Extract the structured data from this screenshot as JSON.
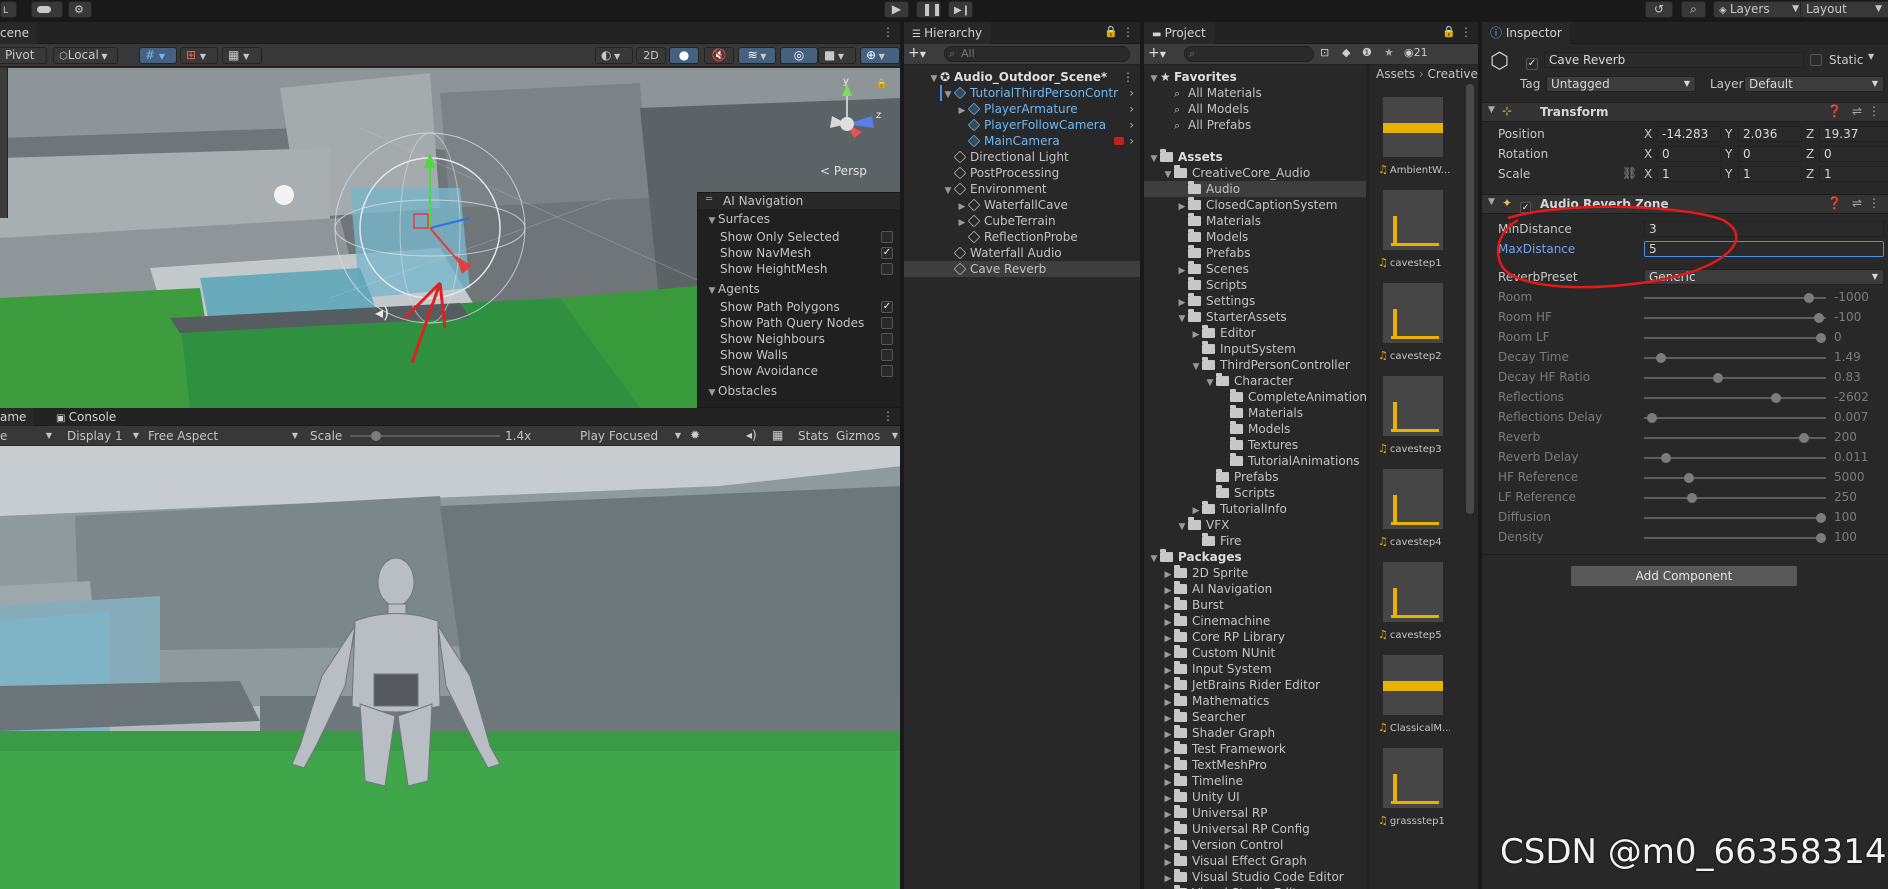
{
  "toolbar": {
    "layers_label": "Layers",
    "layout_label": "Layout"
  },
  "scene": {
    "tab": "cene",
    "pivot": "Pivot",
    "local": "Local",
    "mode_2d": "2D",
    "persp": "Persp",
    "ai_nav": {
      "title": "AI Navigation",
      "sections": [
        {
          "title": "Surfaces",
          "items": [
            {
              "label": "Show Only Selected",
              "checked": false
            },
            {
              "label": "Show NavMesh",
              "checked": true
            },
            {
              "label": "Show HeightMesh",
              "checked": false
            }
          ]
        },
        {
          "title": "Agents",
          "items": [
            {
              "label": "Show Path Polygons",
              "checked": true
            },
            {
              "label": "Show Path Query Nodes",
              "checked": false
            },
            {
              "label": "Show Neighbours",
              "checked": false
            },
            {
              "label": "Show Walls",
              "checked": false
            },
            {
              "label": "Show Avoidance",
              "checked": false
            }
          ]
        },
        {
          "title": "Obstacles",
          "items": []
        }
      ]
    }
  },
  "game": {
    "tab": "ame",
    "console_tab": "Console",
    "display_left": "e",
    "display": "Display 1",
    "aspect": "Free Aspect",
    "scale_label": "Scale",
    "scale_value": "1.4x",
    "scale_fraction": 0.15,
    "play_focused": "Play Focused",
    "stats": "Stats",
    "gizmos": "Gizmos"
  },
  "hierarchy": {
    "tab": "Hierarchy",
    "search_placeholder": "All",
    "items": [
      {
        "label": "Audio_Outdoor_Scene*",
        "depth": 0,
        "type": "scene",
        "arrow": "down",
        "blue": false,
        "bold": true,
        "selected": false,
        "more": true
      },
      {
        "label": "TutorialThirdPersonContr",
        "depth": 1,
        "type": "cube",
        "arrow": "down",
        "blue": true,
        "bold": false,
        "selected": false,
        "chevron": true
      },
      {
        "label": "PlayerArmature",
        "depth": 2,
        "type": "cube",
        "arrow": "right",
        "blue": true,
        "bold": false,
        "selected": false,
        "chevron": true
      },
      {
        "label": "PlayerFollowCamera",
        "depth": 2,
        "type": "cube",
        "arrow": "",
        "blue": true,
        "bold": false,
        "selected": false,
        "chevron": true
      },
      {
        "label": "MainCamera",
        "depth": 2,
        "type": "cube",
        "arrow": "",
        "blue": true,
        "bold": false,
        "selected": false,
        "chevron": true,
        "warn": true
      },
      {
        "label": "Directional Light",
        "depth": 1,
        "type": "cube",
        "arrow": "",
        "blue": false,
        "bold": false,
        "selected": false
      },
      {
        "label": "PostProcessing",
        "depth": 1,
        "type": "cube",
        "arrow": "",
        "blue": false,
        "bold": false,
        "selected": false
      },
      {
        "label": "Environment",
        "depth": 1,
        "type": "cube",
        "arrow": "down",
        "blue": false,
        "bold": false,
        "selected": false
      },
      {
        "label": "WaterfallCave",
        "depth": 2,
        "type": "cube",
        "arrow": "right",
        "blue": false,
        "bold": false,
        "selected": false
      },
      {
        "label": "CubeTerrain",
        "depth": 2,
        "type": "cube",
        "arrow": "right",
        "blue": false,
        "bold": false,
        "selected": false
      },
      {
        "label": "ReflectionProbe",
        "depth": 2,
        "type": "cube",
        "arrow": "",
        "blue": false,
        "bold": false,
        "selected": false
      },
      {
        "label": "Waterfall Audio",
        "depth": 1,
        "type": "cube",
        "arrow": "",
        "blue": false,
        "bold": false,
        "selected": false
      },
      {
        "label": "Cave Reverb",
        "depth": 1,
        "type": "cube",
        "arrow": "",
        "blue": false,
        "bold": false,
        "selected": true
      }
    ]
  },
  "project": {
    "tab": "Project",
    "hidden_count": "21",
    "breadcrumb_assets": "Assets",
    "breadcrumb_next": "CreativeC",
    "tree": [
      {
        "label": "Favorites",
        "depth": 0,
        "type": "star",
        "arrow": "down",
        "bold": true
      },
      {
        "label": "All Materials",
        "depth": 1,
        "type": "search",
        "arrow": ""
      },
      {
        "label": "All Models",
        "depth": 1,
        "type": "search",
        "arrow": ""
      },
      {
        "label": "All Prefabs",
        "depth": 1,
        "type": "search",
        "arrow": ""
      },
      {
        "label": "",
        "depth": 0,
        "type": "gap",
        "arrow": ""
      },
      {
        "label": "Assets",
        "depth": 0,
        "type": "folder",
        "arrow": "down",
        "bold": true
      },
      {
        "label": "CreativeCore_Audio",
        "depth": 1,
        "type": "folder",
        "arrow": "down"
      },
      {
        "label": "Audio",
        "depth": 2,
        "type": "folder",
        "arrow": "",
        "selected": true
      },
      {
        "label": "ClosedCaptionSystem",
        "depth": 2,
        "type": "folder",
        "arrow": "right"
      },
      {
        "label": "Materials",
        "depth": 2,
        "type": "folder",
        "arrow": ""
      },
      {
        "label": "Models",
        "depth": 2,
        "type": "folder",
        "arrow": ""
      },
      {
        "label": "Prefabs",
        "depth": 2,
        "type": "folder",
        "arrow": ""
      },
      {
        "label": "Scenes",
        "depth": 2,
        "type": "folder",
        "arrow": "right"
      },
      {
        "label": "Scripts",
        "depth": 2,
        "type": "folder",
        "arrow": ""
      },
      {
        "label": "Settings",
        "depth": 2,
        "type": "folder",
        "arrow": "right"
      },
      {
        "label": "StarterAssets",
        "depth": 2,
        "type": "folder",
        "arrow": "down"
      },
      {
        "label": "Editor",
        "depth": 3,
        "type": "folder",
        "arrow": "right"
      },
      {
        "label": "InputSystem",
        "depth": 3,
        "type": "folder",
        "arrow": ""
      },
      {
        "label": "ThirdPersonController",
        "depth": 3,
        "type": "folder",
        "arrow": "down"
      },
      {
        "label": "Character",
        "depth": 4,
        "type": "folder",
        "arrow": "down"
      },
      {
        "label": "CompleteAnimations",
        "depth": 5,
        "type": "folder",
        "arrow": ""
      },
      {
        "label": "Materials",
        "depth": 5,
        "type": "folder",
        "arrow": ""
      },
      {
        "label": "Models",
        "depth": 5,
        "type": "folder",
        "arrow": ""
      },
      {
        "label": "Textures",
        "depth": 5,
        "type": "folder",
        "arrow": ""
      },
      {
        "label": "TutorialAnimations",
        "depth": 5,
        "type": "folder",
        "arrow": ""
      },
      {
        "label": "Prefabs",
        "depth": 4,
        "type": "folder",
        "arrow": ""
      },
      {
        "label": "Scripts",
        "depth": 4,
        "type": "folder",
        "arrow": ""
      },
      {
        "label": "TutorialInfo",
        "depth": 3,
        "type": "folder",
        "arrow": "right"
      },
      {
        "label": "VFX",
        "depth": 2,
        "type": "folder",
        "arrow": "down"
      },
      {
        "label": "Fire",
        "depth": 3,
        "type": "folder",
        "arrow": ""
      },
      {
        "label": "Packages",
        "depth": 0,
        "type": "folder",
        "arrow": "down",
        "bold": true
      },
      {
        "label": "2D Sprite",
        "depth": 1,
        "type": "folder",
        "arrow": "right"
      },
      {
        "label": "AI Navigation",
        "depth": 1,
        "type": "folder",
        "arrow": "right"
      },
      {
        "label": "Burst",
        "depth": 1,
        "type": "folder",
        "arrow": "right"
      },
      {
        "label": "Cinemachine",
        "depth": 1,
        "type": "folder",
        "arrow": "right"
      },
      {
        "label": "Core RP Library",
        "depth": 1,
        "type": "folder",
        "arrow": "right"
      },
      {
        "label": "Custom NUnit",
        "depth": 1,
        "type": "folder",
        "arrow": "right"
      },
      {
        "label": "Input System",
        "depth": 1,
        "type": "folder",
        "arrow": "right"
      },
      {
        "label": "JetBrains Rider Editor",
        "depth": 1,
        "type": "folder",
        "arrow": "right"
      },
      {
        "label": "Mathematics",
        "depth": 1,
        "type": "folder",
        "arrow": "right"
      },
      {
        "label": "Searcher",
        "depth": 1,
        "type": "folder",
        "arrow": "right"
      },
      {
        "label": "Shader Graph",
        "depth": 1,
        "type": "folder",
        "arrow": "right"
      },
      {
        "label": "Test Framework",
        "depth": 1,
        "type": "folder",
        "arrow": "right"
      },
      {
        "label": "TextMeshPro",
        "depth": 1,
        "type": "folder",
        "arrow": "right"
      },
      {
        "label": "Timeline",
        "depth": 1,
        "type": "folder",
        "arrow": "right"
      },
      {
        "label": "Unity UI",
        "depth": 1,
        "type": "folder",
        "arrow": "right"
      },
      {
        "label": "Universal RP",
        "depth": 1,
        "type": "folder",
        "arrow": "right"
      },
      {
        "label": "Universal RP Config",
        "depth": 1,
        "type": "folder",
        "arrow": "right"
      },
      {
        "label": "Version Control",
        "depth": 1,
        "type": "folder",
        "arrow": "right"
      },
      {
        "label": "Visual Effect Graph",
        "depth": 1,
        "type": "folder",
        "arrow": "right"
      },
      {
        "label": "Visual Studio Code Editor",
        "depth": 1,
        "type": "folder",
        "arrow": "right"
      },
      {
        "label": "Visual Studio Editor",
        "depth": 1,
        "type": "folder",
        "arrow": "right"
      }
    ],
    "assets": [
      {
        "label": "AmbientW...",
        "wave": "dense"
      },
      {
        "label": "cavestep1",
        "wave": "spike"
      },
      {
        "label": "cavestep2",
        "wave": "spike"
      },
      {
        "label": "cavestep3",
        "wave": "spike"
      },
      {
        "label": "cavestep4",
        "wave": "spike"
      },
      {
        "label": "cavestep5",
        "wave": "spike"
      },
      {
        "label": "ClassicalM...",
        "wave": "dense"
      },
      {
        "label": "grassstep1",
        "wave": "spike"
      }
    ]
  },
  "inspector": {
    "tab": "Inspector",
    "object_name": "Cave Reverb",
    "static_label": "Static",
    "tag_label": "Tag",
    "tag_value": "Untagged",
    "layer_label": "Layer",
    "layer_value": "Default",
    "transform": {
      "title": "Transform",
      "position": {
        "label": "Position",
        "x": "-14.283",
        "y": "2.036",
        "z": "19.37"
      },
      "rotation": {
        "label": "Rotation",
        "x": "0",
        "y": "0",
        "z": "0"
      },
      "scale": {
        "label": "Scale",
        "x": "1",
        "y": "1",
        "z": "1"
      }
    },
    "reverb_zone": {
      "title": "Audio Reverb Zone",
      "min_distance": {
        "label": "MinDistance",
        "value": "3"
      },
      "max_distance": {
        "label": "MaxDistance",
        "value": "5"
      },
      "preset": {
        "label": "ReverbPreset",
        "value": "Generic"
      },
      "params": [
        {
          "label": "Room",
          "value": "-1000",
          "fraction": 0.93
        },
        {
          "label": "Room HF",
          "value": "-100",
          "fraction": 0.99
        },
        {
          "label": "Room LF",
          "value": "0",
          "fraction": 1.0
        },
        {
          "label": "Decay Time",
          "value": "1.49",
          "fraction": 0.07
        },
        {
          "label": "Decay HF Ratio",
          "value": "0.83",
          "fraction": 0.4
        },
        {
          "label": "Reflections",
          "value": "-2602",
          "fraction": 0.74
        },
        {
          "label": "Reflections Delay",
          "value": "0.007",
          "fraction": 0.02
        },
        {
          "label": "Reverb",
          "value": "200",
          "fraction": 0.9
        },
        {
          "label": "Reverb Delay",
          "value": "0.011",
          "fraction": 0.1
        },
        {
          "label": "HF Reference",
          "value": "5000",
          "fraction": 0.23
        },
        {
          "label": "LF Reference",
          "value": "250",
          "fraction": 0.25
        },
        {
          "label": "Diffusion",
          "value": "100",
          "fraction": 1.0
        },
        {
          "label": "Density",
          "value": "100",
          "fraction": 1.0
        }
      ]
    },
    "add_component": "Add Component"
  },
  "watermark": "CSDN @m0_66358314"
}
